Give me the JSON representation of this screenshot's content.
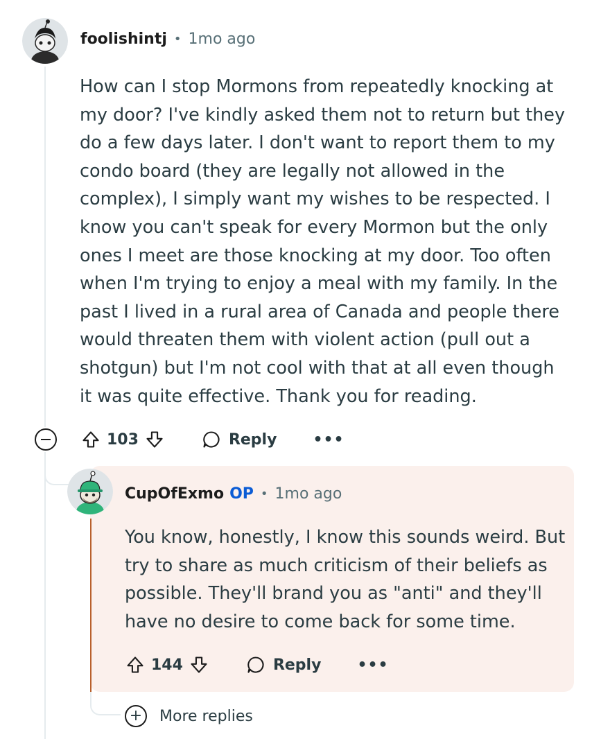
{
  "comment": {
    "username": "foolishintj",
    "separator": "•",
    "time": "1mo ago",
    "lines": [
      "How can I stop Mormons from repeatedly knocking at",
      "my door? I've kindly asked them not to return but they",
      "do a few days later. I don't want to report them to my",
      "condo board (they are legally not allowed in the",
      "complex), I simply want my wishes to be respected. I",
      "know you can't speak for every Mormon but the only",
      "ones I meet are those knocking at my door. Too often",
      "when I'm trying to enjoy a meal with my family. In the",
      "past I lived in a rural area of Canada and people there",
      "would threaten them with violent action (pull out a",
      "shotgun) but I'm not cool with that at all even though",
      "it was quite effective. Thank you for reading."
    ],
    "score": "103",
    "reply_label": "Reply",
    "more_label": "•••"
  },
  "reply": {
    "username": "CupOfExmo",
    "op_badge": "OP",
    "separator": "•",
    "time": "1mo ago",
    "lines": [
      "You know, honestly, I know this sounds weird. But",
      "try to share as much criticism of their beliefs as",
      "possible. They'll brand you as \"anti\" and they'll",
      "have no desire to come back for some time."
    ],
    "score": "144",
    "reply_label": "Reply",
    "more_label": "•••"
  },
  "more_replies": {
    "icon_glyph": "+",
    "label": "More replies"
  },
  "colors": {
    "meta_gray": "#576f76",
    "op_blue": "#0b5cd5",
    "reply_bg": "#fbf0ec",
    "accent_line": "#b8602c",
    "thread_line": "#e5ebee"
  },
  "icons": [
    "avatar-snoo",
    "upvote-arrow-icon",
    "downvote-arrow-icon",
    "comment-bubble-icon",
    "ellipsis-icon",
    "collapse-minus-icon",
    "plus-circle-icon"
  ]
}
